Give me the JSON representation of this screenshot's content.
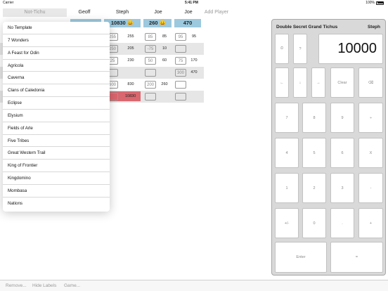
{
  "status_bar": {
    "carrier": "Carrier",
    "time": "5:41 PM",
    "battery": "100%"
  },
  "header": {
    "template": "Not-Tichu",
    "players": [
      "Geoff",
      "Steph",
      "Joe",
      "Joe"
    ],
    "add_player": "Add Player"
  },
  "scores": {
    "steph": "10830 😀",
    "joe1": "260 😀",
    "joe2": "470"
  },
  "rows": [
    {
      "steph_in": "255",
      "steph_val": "255",
      "joe1_in": "85",
      "joe1_val": "85",
      "joe2_in": "95",
      "joe2_val": "95"
    },
    {
      "steph_in": "250",
      "steph_val": "205",
      "joe1_in": "-75",
      "joe1_val": "10",
      "joe2_in": "",
      "joe2_val": ""
    },
    {
      "steph_in": "25",
      "steph_val": "230",
      "joe1_in": "50",
      "joe1_val": "60",
      "joe2_in": "75",
      "joe2_val": "170"
    },
    {
      "steph_in": "",
      "steph_val": "",
      "joe1_in": "",
      "joe1_val": "",
      "joe2_in": "300",
      "joe2_val": "470"
    },
    {
      "steph_in": "600",
      "steph_val": "830",
      "joe1_in": "200",
      "joe1_val": "260",
      "joe2_in": "",
      "joe2_val": ""
    },
    {
      "steph_in": "",
      "steph_val": "10830",
      "joe1_in": "",
      "joe1_val": "",
      "joe2_in": "",
      "joe2_val": ""
    }
  ],
  "templates": [
    "No Template",
    "7 Wonders",
    "A Feast for Odin",
    "Agricola",
    "Caverna",
    "Clans of Caledonia",
    "Eclipse",
    "Elysium",
    "Fields of Arle",
    "Five Tribes",
    "Great Western Trail",
    "King of Frontier",
    "Kingdomino",
    "Mombasa",
    "Nations"
  ],
  "calculator": {
    "title": "Double Secret Grand Tichus",
    "player": "Steph",
    "display": "10000",
    "keys": {
      "clock": "⏲",
      "help": "?",
      "left": "←",
      "down": "↓",
      "right": "→",
      "clear": "Clear",
      "backspace": "⌫",
      "seven": "7",
      "eight": "8",
      "nine": "9",
      "divide": "÷",
      "four": "4",
      "five": "5",
      "six": "6",
      "multiply": "X",
      "one": "1",
      "two": "2",
      "three": "3",
      "minus": "-",
      "plusminus": "+/-",
      "zero": "0",
      "dot": ".",
      "plus": "+",
      "enter": "Enter",
      "equals": "="
    }
  },
  "toolbar": {
    "remove": "Remove...",
    "hide_labels": "Hide Labels",
    "game": "Game..."
  },
  "colors": {
    "score_blue": "#9cc9de",
    "negative_red": "#d9676f",
    "panel_gray": "#d9d9d9"
  }
}
